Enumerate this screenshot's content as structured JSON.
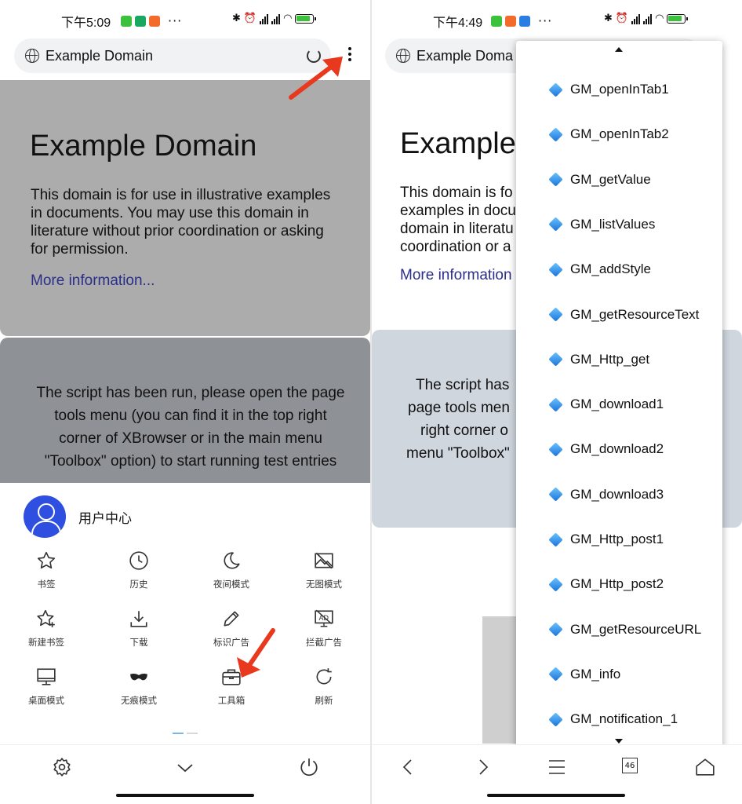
{
  "left": {
    "status": {
      "time": "下午5:09",
      "dots": "···"
    },
    "url": {
      "text": "Example Domain"
    },
    "page": {
      "heading": "Example Domain",
      "paragraph": "This domain is for use in illustrative examples in documents. You may use this domain in literature without prior coordination or asking for permission.",
      "link": "More information..."
    },
    "script_notice": "The script has been run, please open the page tools menu (you can find it in the top right corner of XBrowser or in the main menu \"Toolbox\" option) to start running test entries",
    "sheet": {
      "user_center": "用户中心",
      "items": [
        {
          "label": "书签",
          "icon": "star-icon"
        },
        {
          "label": "历史",
          "icon": "clock-icon"
        },
        {
          "label": "夜间模式",
          "icon": "moon-icon"
        },
        {
          "label": "无图模式",
          "icon": "no-image-icon"
        },
        {
          "label": "新建书签",
          "icon": "star-plus-icon"
        },
        {
          "label": "下载",
          "icon": "download-icon"
        },
        {
          "label": "标识广告",
          "icon": "pencil-icon"
        },
        {
          "label": "拦截广告",
          "icon": "ad-block-icon"
        },
        {
          "label": "桌面模式",
          "icon": "monitor-icon"
        },
        {
          "label": "无痕模式",
          "icon": "mask-icon"
        },
        {
          "label": "工具箱",
          "icon": "toolbox-icon"
        },
        {
          "label": "刷新",
          "icon": "refresh-icon"
        }
      ]
    },
    "bottom": {
      "icons": [
        "gear-icon",
        "chevron-down-icon",
        "power-icon"
      ]
    }
  },
  "right": {
    "status": {
      "time": "下午4:49",
      "dots": "···"
    },
    "url": {
      "text": "Example Doma"
    },
    "page": {
      "heading": "Example",
      "line1": "This domain is fo",
      "line2": "examples in docu",
      "line3": "domain in literatu",
      "line4": "coordination or a",
      "link": "More information"
    },
    "script_notice": {
      "line1": "The script has",
      "line2": "page tools men",
      "line3": "right corner o",
      "line4": "menu \"Toolbox\""
    },
    "menu": {
      "items": [
        "GM_openInTab1",
        "GM_openInTab2",
        "GM_getValue",
        "GM_listValues",
        "GM_addStyle",
        "GM_getResourceText",
        "GM_Http_get",
        "GM_download1",
        "GM_download2",
        "GM_download3",
        "GM_Http_post1",
        "GM_Http_post2",
        "GM_getResourceURL",
        "GM_info",
        "GM_notification_1"
      ]
    },
    "bottom": {
      "tab_count": "46",
      "icons": [
        "back-icon",
        "forward-icon",
        "menu-icon",
        "tabs-icon",
        "home-icon"
      ]
    }
  },
  "colors": {
    "accent_red": "#e8391e",
    "avatar_blue": "#2e4fe0",
    "link_blue": "#2b2e8a",
    "overlay_gray": "#acacac"
  }
}
